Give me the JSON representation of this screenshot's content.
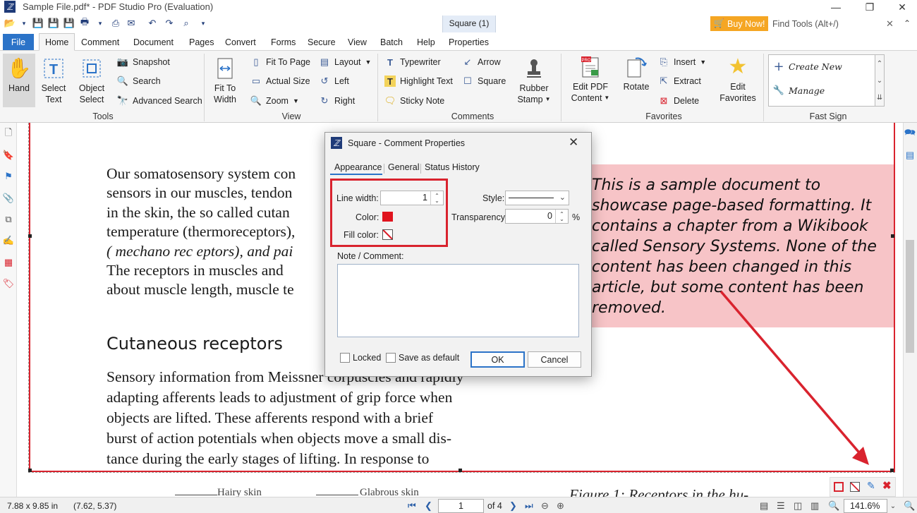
{
  "app": {
    "title": "Sample File.pdf* - PDF Studio Pro (Evaluation)",
    "buy_now": "Buy Now!",
    "find_tools_placeholder": "Find Tools  (Alt+/)"
  },
  "tabs": [
    "File",
    "Home",
    "Comment",
    "Document",
    "Pages",
    "Convert",
    "Forms",
    "Secure",
    "View",
    "Batch",
    "Help"
  ],
  "context_tab": {
    "group": "Square (1)",
    "tab": "Properties"
  },
  "ribbon": {
    "tools": {
      "label": "Tools",
      "hand": "Hand",
      "select_text": [
        "Select",
        "Text"
      ],
      "select_object": [
        "Object",
        "Select"
      ],
      "snapshot": "Snapshot",
      "search": "Search",
      "advanced_search": "Advanced Search"
    },
    "view": {
      "label": "View",
      "fit_to_width": [
        "Fit To",
        "Width"
      ],
      "fit_to_page": "Fit To Page",
      "actual_size": "Actual Size",
      "zoom": "Zoom",
      "layout": "Layout",
      "left": "Left",
      "right": "Right"
    },
    "comments": {
      "label": "Comments",
      "typewriter": "Typewriter",
      "highlight_text": "Highlight Text",
      "sticky_note": "Sticky Note",
      "arrow": "Arrow",
      "square": "Square",
      "rubber_stamp": [
        "Rubber",
        "Stamp"
      ]
    },
    "favorites": {
      "label": "Favorites",
      "edit_pdf_content": [
        "Edit PDF",
        "Content"
      ],
      "rotate": "Rotate",
      "insert": "Insert",
      "extract": "Extract",
      "delete": "Delete",
      "edit_favorites": [
        "Edit",
        "Favorites"
      ]
    },
    "fast_sign": {
      "label": "Fast Sign",
      "create_new": "Create New",
      "manage": "Manage"
    }
  },
  "document": {
    "paragraph1": [
      "Our somatosensory system con",
      "sensors in our  muscles, tendon",
      "in the skin, the so  called cutan",
      "temperature (thermoreceptors),",
      "( mechano rec eptors), and pai",
      "The receptors in muscles and",
      "about muscle length, muscle   te"
    ],
    "heading": "Cutaneous receptors",
    "paragraph2": [
      "Sensory information from Meissner corpuscles and rapidly",
      "adapting afferents leads to adjustment of grip force when",
      "objects are lifted. These afferents respond with a brief",
      "burst of action potentials when objects move a small dis-",
      "tance during the early stages of lifting. In response to"
    ],
    "note": "This is a sample document to showcase page-based formatting. It contains a chapter from a Wikibook called Sensory Systems. None of the content has been changed in this article, but some content has been removed.",
    "caption": "Figure  1:    Receptors  in  the  hu-",
    "figure_labels": [
      "Hairy skin",
      "Glabrous skin"
    ]
  },
  "dialog": {
    "title": "Square - Comment Properties",
    "tabs": [
      "Appearance",
      "General",
      "Status History"
    ],
    "line_width_label": "Line width:",
    "line_width": "1",
    "color_label": "Color:",
    "fill_color_label": "Fill color:",
    "style_label": "Style:",
    "transparency_label": "Transparency:",
    "transparency": "0",
    "percent": "%",
    "note_label": "Note / Comment:",
    "note_value": "",
    "locked_label": "Locked",
    "save_default_label": "Save as default",
    "ok": "OK",
    "cancel": "Cancel",
    "color_hex": "#e0141e"
  },
  "status": {
    "page_size": "7.88 x 9.85 in",
    "coords": "(7.62, 5.37)",
    "page": "1",
    "of_pages": "of 4",
    "zoom": "141.6%"
  }
}
